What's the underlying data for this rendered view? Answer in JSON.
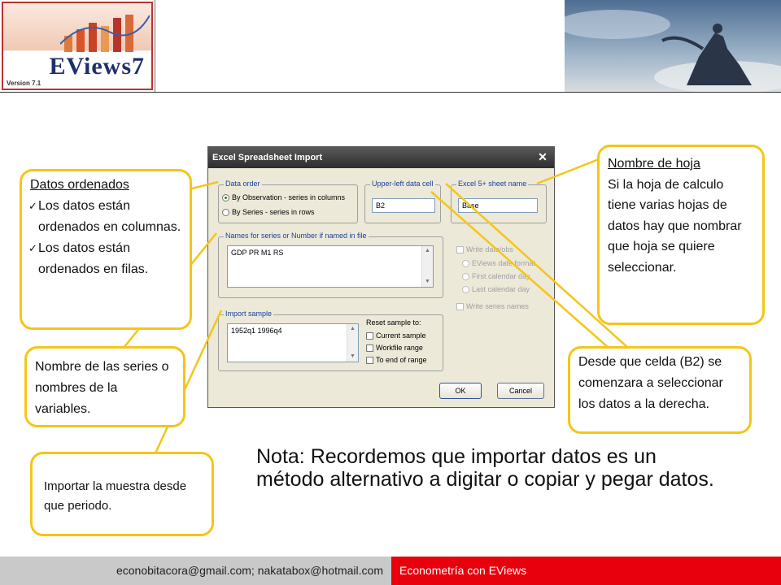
{
  "header": {
    "logo_title": "EViews7",
    "logo_version": "Version 7.1"
  },
  "dialog": {
    "title": "Excel Spreadsheet Import",
    "data_order": {
      "label": "Data order",
      "options": [
        "By Observation - series in columns",
        "By Series - series in rows"
      ],
      "selected": 0
    },
    "upper_left": {
      "label": "Upper-left data cell",
      "value": "B2"
    },
    "sheet_name": {
      "label": "Excel 5+ sheet name",
      "value": "Base"
    },
    "names": {
      "label": "Names for series or Number if named in file",
      "value": "GDP PR M1 RS"
    },
    "right_options": {
      "write_date": "Write date/obs",
      "eviews_date": "EViews date format",
      "first_calendar": "First calendar day",
      "last_calendar": "Last calendar day",
      "write_series": "Write series names"
    },
    "import_sample": {
      "label": "Import sample",
      "value": "1952q1 1996q4"
    },
    "reset_sample": {
      "label": "Reset sample to:",
      "options": [
        "Current sample",
        "Workfile range",
        "To end of range"
      ]
    },
    "ok_label": "OK",
    "cancel_label": "Cancel"
  },
  "callouts": {
    "datos": {
      "title": "Datos ordenados",
      "items": [
        "Los datos están ordenados  en columnas.",
        "Los datos están ordenados en filas."
      ]
    },
    "nombre_series": "Nombre de las series o nombres de la variables.",
    "importar": "Importar la muestra desde que periodo.",
    "hoja": {
      "title": "Nombre de hoja",
      "text": "Si la hoja de calculo tiene varias hojas de datos hay que nombrar que hoja se quiere seleccionar."
    },
    "celda": "Desde que celda (B2) se comenzara a seleccionar los datos a la derecha."
  },
  "note": "Nota: Recordemos que importar datos es un método alternativo a digitar o copiar y pegar datos.",
  "footer": {
    "emails": "econobitacora@gmail.com;  nakatabox@hotmail.com",
    "course": "Econometría con EViews"
  },
  "colors": {
    "callout_border": "#f5c518",
    "footer_red": "#e8000d",
    "footer_gray": "#c9c9c9"
  }
}
